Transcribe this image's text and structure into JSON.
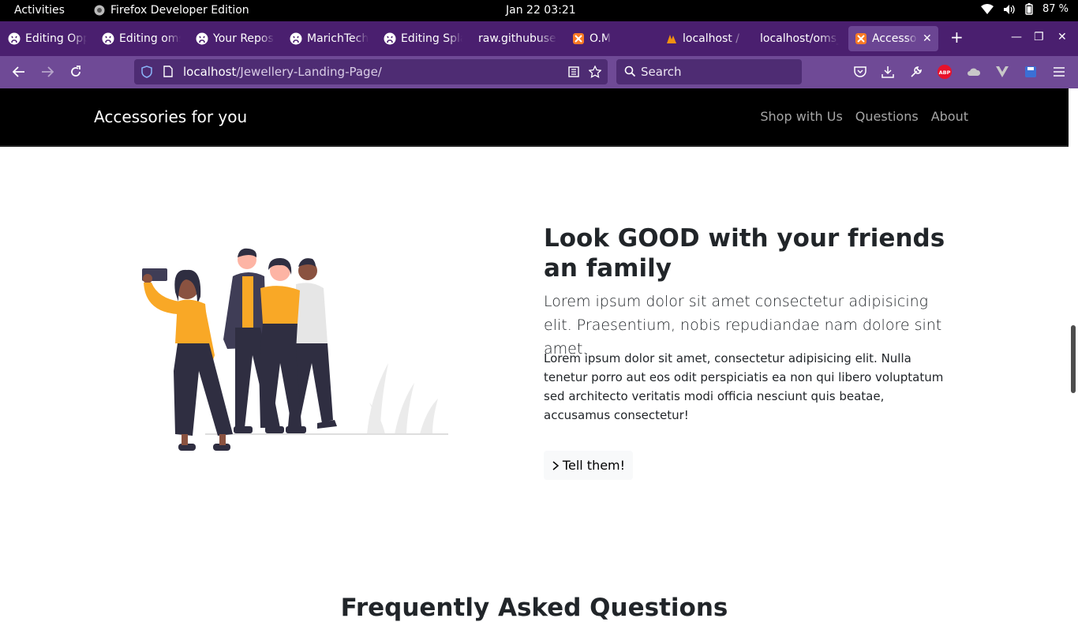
{
  "os_bar": {
    "activities": "Activities",
    "app_name": "Firefox Developer Edition",
    "datetime": "Jan 22  03:21",
    "battery": "87 %"
  },
  "tabs": [
    {
      "label": "Editing Opportunities",
      "icon": "github-icon"
    },
    {
      "label": "Editing oms",
      "icon": "github-icon"
    },
    {
      "label": "Your Repositories",
      "icon": "github-icon"
    },
    {
      "label": "MarichTech",
      "icon": "github-icon"
    },
    {
      "label": "Editing Splash",
      "icon": "github-icon"
    },
    {
      "label": "raw.githubusercontent",
      "icon": "none"
    },
    {
      "label": "O.M",
      "icon": "xampp-icon"
    },
    {
      "label": "localhost / localhost",
      "icon": "phpmyadmin-icon"
    },
    {
      "label": "localhost/oms_",
      "icon": "none"
    },
    {
      "label": "Accessories for you",
      "icon": "xampp-icon",
      "active": true
    }
  ],
  "toolbar": {
    "url_host": "localhost",
    "url_path": "/Jewellery-Landing-Page/",
    "search_placeholder": "Search"
  },
  "site": {
    "brand": "Accessories for you",
    "nav": [
      "Shop with Us",
      "Questions",
      "About"
    ]
  },
  "hero": {
    "heading": "Look GOOD with your friends an family",
    "lead": "Lorem ipsum dolor sit amet consectetur adipisicing elit. Praesentium, nobis repudiandae nam dolore sint amet.",
    "body": "Lorem ipsum dolor sit amet, consectetur adipisicing elit. Nulla tenetur porro aut eos odit perspiciatis ea non qui libero voluptatum sed architecto veritatis modi officia nesciunt quis beatae, accusamus consectetur!",
    "button": "Tell them!"
  },
  "faq_heading": "Frequently Asked Questions",
  "colors": {
    "tabbar": "#4a1f6f",
    "toolbar": "#6f4a96",
    "accent_yellow": "#f9a826",
    "dark_figure": "#2f2e41"
  }
}
